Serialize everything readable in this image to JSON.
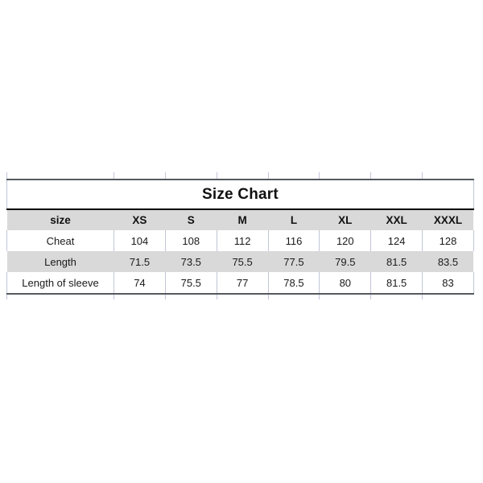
{
  "chart_data": {
    "type": "table",
    "title": "Size Chart",
    "label_header": "size",
    "categories": [
      "XS",
      "S",
      "M",
      "L",
      "XL",
      "XXL",
      "XXXL"
    ],
    "series": [
      {
        "name": "Cheat",
        "values": [
          "104",
          "108",
          "112",
          "116",
          "120",
          "124",
          "128"
        ]
      },
      {
        "name": "Length",
        "values": [
          "71.5",
          "73.5",
          "75.5",
          "77.5",
          "79.5",
          "81.5",
          "83.5"
        ]
      },
      {
        "name": "Length of sleeve",
        "values": [
          "74",
          "75.5",
          "77",
          "78.5",
          "80",
          "81.5",
          "83"
        ]
      }
    ],
    "row_shading": [
      false,
      true,
      false
    ],
    "colors": {
      "page_background": "#ffffff",
      "shaded_row": "#d9d9d9",
      "plain_row": "#ffffff",
      "text": "#1a1a1a",
      "title_text": "#111111",
      "grid_line": "#c2c6d6",
      "heavy_rule": "#555a5e",
      "title_bottom_rule": "#000000"
    }
  }
}
